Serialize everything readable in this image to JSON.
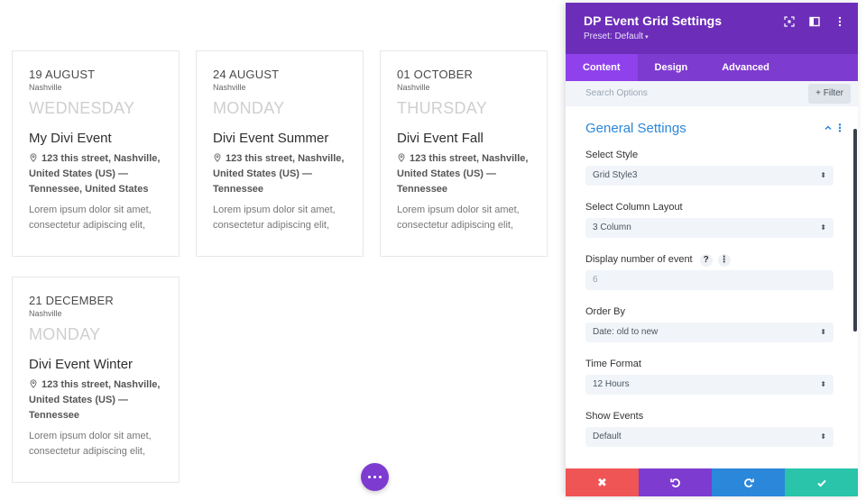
{
  "events": [
    {
      "date": "19 AUGUST",
      "city": "Nashville",
      "weekday": "WEDNESDAY",
      "title": "My Divi Event",
      "address": "123 this street, Nashville, United States (US) — Tennessee, United States",
      "description": "Lorem ipsum dolor sit amet, consectetur adipiscing elit,"
    },
    {
      "date": "24 AUGUST",
      "city": "Nashville",
      "weekday": "MONDAY",
      "title": "Divi Event Summer",
      "address": "123 this street, Nashville, United States (US) — Tennessee",
      "description": "Lorem ipsum dolor sit amet, consectetur adipiscing elit,"
    },
    {
      "date": "01 OCTOBER",
      "city": "Nashville",
      "weekday": "THURSDAY",
      "title": "Divi Event Fall",
      "address": "123 this street, Nashville, United States (US) — Tennessee",
      "description": "Lorem ipsum dolor sit amet, consectetur adipiscing elit,"
    },
    {
      "date": "21 DECEMBER",
      "city": "Nashville",
      "weekday": "MONDAY",
      "title": "Divi Event Winter",
      "address": "123 this street, Nashville, United States (US) — Tennessee",
      "description": "Lorem ipsum dolor sit amet, consectetur adipiscing elit,"
    }
  ],
  "panel": {
    "title": "DP Event Grid Settings",
    "preset": "Preset: Default",
    "tabs": [
      "Content",
      "Design",
      "Advanced"
    ],
    "active_tab": "Content",
    "search_placeholder": "Search Options",
    "filter_label": "+ Filter",
    "section_title": "General Settings",
    "fields": {
      "select_style": {
        "label": "Select Style",
        "value": "Grid Style3"
      },
      "column_layout": {
        "label": "Select Column Layout",
        "value": "3 Column"
      },
      "display_number": {
        "label": "Display number of event",
        "value": "6",
        "help": "?"
      },
      "order_by": {
        "label": "Order By",
        "value": "Date: old to new"
      },
      "time_format": {
        "label": "Time Format",
        "value": "12 Hours"
      },
      "show_events": {
        "label": "Show Events",
        "value": "Default"
      }
    }
  },
  "colors": {
    "header": "#6c2eb9",
    "tabs": "#7e3bd0",
    "active_tab": "#8f42ec",
    "section_title": "#2b87da",
    "footer_discard": "#ef5555",
    "footer_undo": "#7e3bd0",
    "footer_redo": "#2b87da",
    "footer_save": "#29c4a9"
  },
  "icons": {
    "fab": "more-dots-icon",
    "header": [
      "fullscreen-icon",
      "sidebar-layout-icon",
      "more-vertical-icon"
    ],
    "footer": [
      "close-icon",
      "undo-icon",
      "redo-icon",
      "check-icon"
    ],
    "address": "map-pin-icon"
  }
}
